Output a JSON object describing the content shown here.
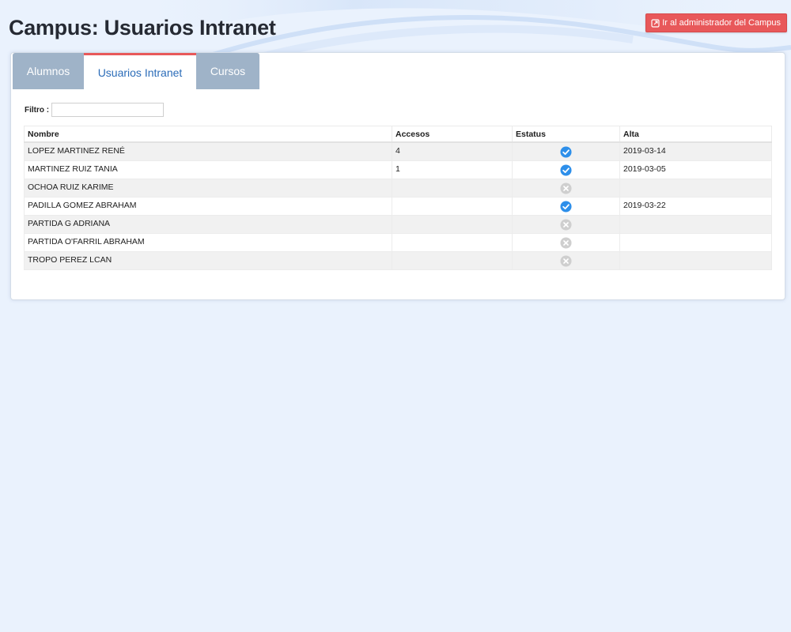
{
  "page": {
    "title": "Campus: Usuarios Intranet"
  },
  "header": {
    "admin_button_label": "Ir al administrador del Campus",
    "admin_button_icon": "external-link-icon"
  },
  "tabs": [
    {
      "label": "Alumnos",
      "active": false
    },
    {
      "label": "Usuarios Intranet",
      "active": true
    },
    {
      "label": "Cursos",
      "active": false
    }
  ],
  "filter": {
    "label": "Filtro :",
    "value": "",
    "placeholder": ""
  },
  "table": {
    "columns": [
      "Nombre",
      "Accesos",
      "Estatus",
      "Alta"
    ],
    "rows": [
      {
        "nombre": "LOPEZ MARTINEZ RENÉ",
        "accesos": "4",
        "estatus": "active",
        "alta": "2019-03-14"
      },
      {
        "nombre": "MARTINEZ RUIZ TANIA",
        "accesos": "1",
        "estatus": "active",
        "alta": "2019-03-05"
      },
      {
        "nombre": "OCHOA RUIZ KARIME",
        "accesos": "",
        "estatus": "inactive",
        "alta": ""
      },
      {
        "nombre": "PADILLA GOMEZ ABRAHAM",
        "accesos": "",
        "estatus": "active",
        "alta": "2019-03-22"
      },
      {
        "nombre": "PARTIDA G ADRIANA",
        "accesos": "",
        "estatus": "inactive",
        "alta": ""
      },
      {
        "nombre": "PARTIDA O'FARRIL ABRAHAM",
        "accesos": "",
        "estatus": "inactive",
        "alta": ""
      },
      {
        "nombre": "TROPO PEREZ LCAN",
        "accesos": "",
        "estatus": "inactive",
        "alta": ""
      }
    ]
  },
  "colors": {
    "background": "#eaf2fd",
    "accent": "#e8585a",
    "tab_inactive": "#9fb3c8",
    "tab_active_text": "#2b6cb8",
    "status_active": "#2d8fea",
    "status_inactive": "#cfcfcf"
  }
}
